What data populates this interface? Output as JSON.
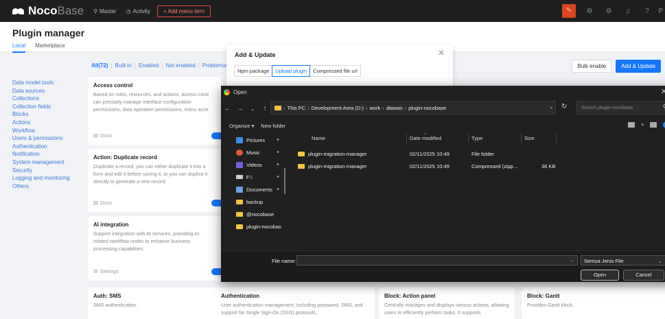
{
  "topbar": {
    "logo_bold": "Noco",
    "logo_light": "Base",
    "master": "Master",
    "activity": "Activity",
    "add_menu": "+ Add menu item"
  },
  "page": {
    "title": "Plugin manager",
    "tabs": [
      "Local",
      "Marketplace"
    ]
  },
  "categories": [
    "Data model tools",
    "Data sources",
    "Collections",
    "Collection fields",
    "Blocks",
    "Actions",
    "Workflow",
    "Users & permissions",
    "Authentication",
    "Notification",
    "System management",
    "Security",
    "Logging and monitoring",
    "Others"
  ],
  "filters": [
    "All(72)",
    "Built-in",
    "Enabled",
    "Not enabled",
    "Problemat"
  ],
  "actions": {
    "bulk": "Bulk enable",
    "add": "Add & Update"
  },
  "cards": [
    {
      "title": "Access control",
      "desc": "Based on roles, resources, and actions, access contr can precisely manage interface configuration permissions, data operation permissions, menu acce",
      "link": "Docs"
    },
    {
      "title": "Action: Duplicate record",
      "desc": "Duplicate a record, you can either duplicate it into a form and edit it before saving it, or you can duplica it directly to generate a new record.",
      "link": "Docs"
    },
    {
      "title": "AI integration",
      "desc": "Support integration with AI services, providing AI-related workflow nodes to enhance business processing capabilities.",
      "link": "Settings"
    }
  ],
  "lower_cards": [
    {
      "title": "Auth: SMS",
      "desc": "SMS authentication."
    },
    {
      "title": "Authentication",
      "desc": "User authentication management, including password, SMS, and support for Single Sign-On (SSO) protocols,"
    },
    {
      "title": "Block: Action panel",
      "desc": "Centrally manages and displays various actions, allowing users to efficiently perform tasks. It supports"
    },
    {
      "title": "Block: Gantt",
      "desc": "Provides Gantt block."
    }
  ],
  "modal": {
    "title": "Add & Update",
    "tabs": [
      "Npm package",
      "Upload plugin",
      "Compressed file url"
    ]
  },
  "dialog": {
    "title": "Open",
    "path": [
      "This PC",
      "Development Area (D:)",
      "work",
      "diawan",
      "plugin-nocobase"
    ],
    "search_placeholder": "Search plugin-nocobase",
    "organize": "Organize ▾",
    "new_folder": "New folder",
    "nav_items": [
      {
        "label": "Pictures",
        "color": "#3d8ee6"
      },
      {
        "label": "Music",
        "color": "#e8553e"
      },
      {
        "label": "Videos",
        "color": "#7b5ce0"
      },
      {
        "label": "F:\\",
        "color": "#cccccc"
      },
      {
        "label": "Documents",
        "color": "#6aa3e8"
      },
      {
        "label": "backup",
        "color": "#f4c342"
      },
      {
        "label": "@nocobase",
        "color": "#f4c342"
      },
      {
        "label": "plugin-nocobas",
        "color": "#f4c342"
      }
    ],
    "columns": {
      "name": "Name",
      "date": "Date modified",
      "type": "Type",
      "size": "Size"
    },
    "files": [
      {
        "name": "plugin-migration-manager",
        "date": "02/11/2025 10:49",
        "type": "File folder",
        "size": ""
      },
      {
        "name": "plugin-migration-manager",
        "date": "02/11/2025 10:49",
        "type": "Compressed (zipp...",
        "size": "36 KB"
      }
    ],
    "file_name_label": "File name:",
    "file_type": "Semua Jenis File",
    "open": "Open",
    "cancel": "Cancel"
  }
}
